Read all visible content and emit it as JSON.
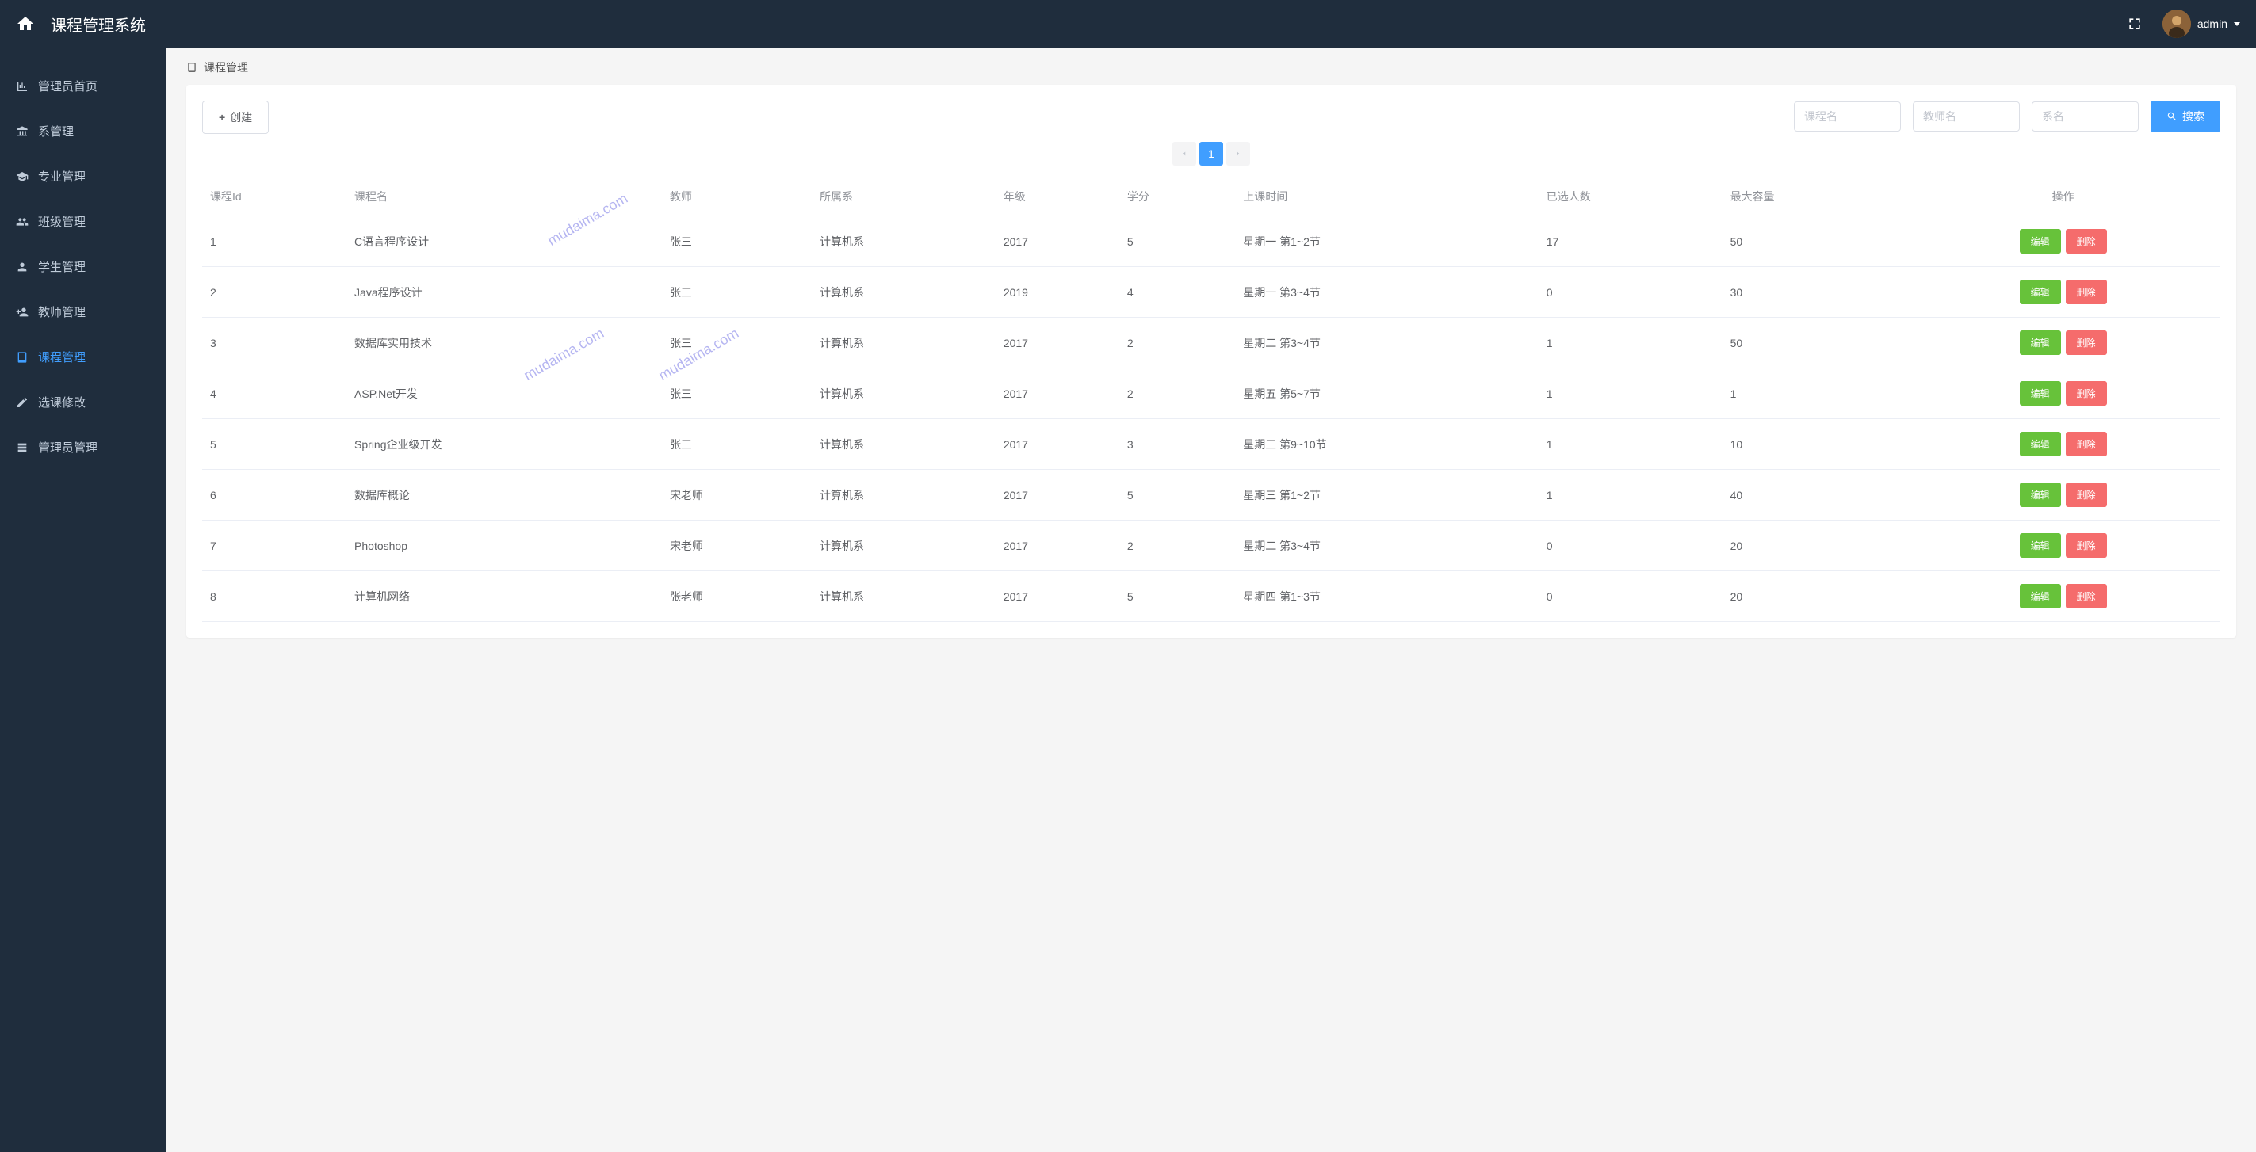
{
  "header": {
    "title": "课程管理系统",
    "username": "admin"
  },
  "sidebar": {
    "items": [
      {
        "label": "管理员首页",
        "icon": "chart"
      },
      {
        "label": "系管理",
        "icon": "building"
      },
      {
        "label": "专业管理",
        "icon": "graduation"
      },
      {
        "label": "班级管理",
        "icon": "users"
      },
      {
        "label": "学生管理",
        "icon": "user"
      },
      {
        "label": "教师管理",
        "icon": "user-plus"
      },
      {
        "label": "课程管理",
        "icon": "book",
        "active": true
      },
      {
        "label": "选课修改",
        "icon": "edit"
      },
      {
        "label": "管理员管理",
        "icon": "admin"
      }
    ]
  },
  "breadcrumb": {
    "title": "课程管理"
  },
  "toolbar": {
    "create_label": "创建",
    "search_label": "搜索",
    "filters": {
      "course_placeholder": "课程名",
      "teacher_placeholder": "教师名",
      "dept_placeholder": "系名"
    }
  },
  "pagination": {
    "current": "1"
  },
  "table": {
    "headers": [
      "课程Id",
      "课程名",
      "教师",
      "所属系",
      "年级",
      "学分",
      "上课时间",
      "已选人数",
      "最大容量",
      "操作"
    ],
    "edit_label": "编辑",
    "delete_label": "删除",
    "rows": [
      {
        "id": "1",
        "name": "C语言程序设计",
        "teacher": "张三",
        "dept": "计算机系",
        "grade": "2017",
        "credit": "5",
        "time": "星期一 第1~2节",
        "enrolled": "17",
        "capacity": "50"
      },
      {
        "id": "2",
        "name": "Java程序设计",
        "teacher": "张三",
        "dept": "计算机系",
        "grade": "2019",
        "credit": "4",
        "time": "星期一 第3~4节",
        "enrolled": "0",
        "capacity": "30"
      },
      {
        "id": "3",
        "name": "数据库实用技术",
        "teacher": "张三",
        "dept": "计算机系",
        "grade": "2017",
        "credit": "2",
        "time": "星期二 第3~4节",
        "enrolled": "1",
        "capacity": "50"
      },
      {
        "id": "4",
        "name": "ASP.Net开发",
        "teacher": "张三",
        "dept": "计算机系",
        "grade": "2017",
        "credit": "2",
        "time": "星期五 第5~7节",
        "enrolled": "1",
        "capacity": "1"
      },
      {
        "id": "5",
        "name": "Spring企业级开发",
        "teacher": "张三",
        "dept": "计算机系",
        "grade": "2017",
        "credit": "3",
        "time": "星期三 第9~10节",
        "enrolled": "1",
        "capacity": "10"
      },
      {
        "id": "6",
        "name": "数据库概论",
        "teacher": "宋老师",
        "dept": "计算机系",
        "grade": "2017",
        "credit": "5",
        "time": "星期三 第1~2节",
        "enrolled": "1",
        "capacity": "40"
      },
      {
        "id": "7",
        "name": "Photoshop",
        "teacher": "宋老师",
        "dept": "计算机系",
        "grade": "2017",
        "credit": "2",
        "time": "星期二 第3~4节",
        "enrolled": "0",
        "capacity": "20"
      },
      {
        "id": "8",
        "name": "计算机网络",
        "teacher": "张老师",
        "dept": "计算机系",
        "grade": "2017",
        "credit": "5",
        "time": "星期四 第1~3节",
        "enrolled": "0",
        "capacity": "20"
      }
    ]
  },
  "watermark": "mudaima.com"
}
